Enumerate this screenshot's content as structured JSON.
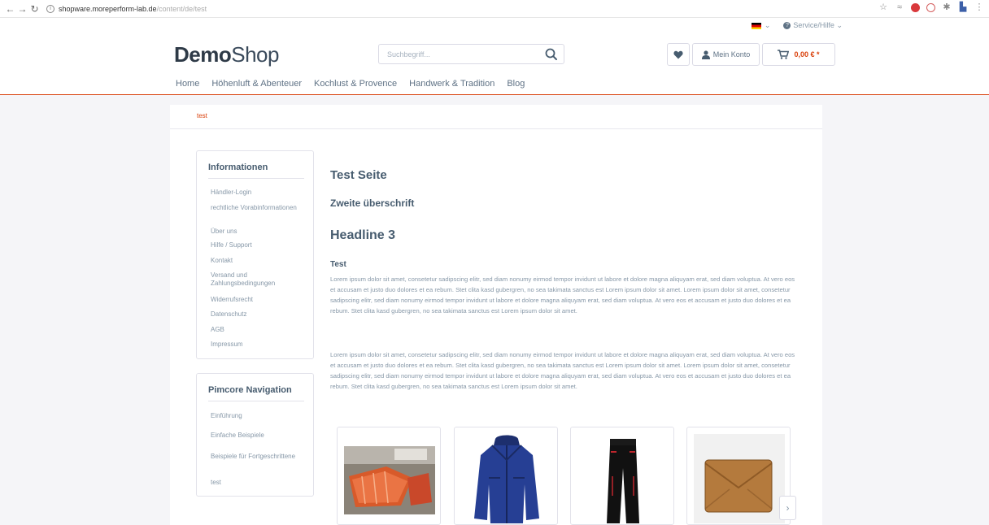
{
  "browser": {
    "back_icon": "back-arrow-icon",
    "forward_icon": "forward-arrow-icon",
    "reload_icon": "reload-icon",
    "url_host": "shopware.moreperform-lab.de",
    "url_path": "/content/de/test"
  },
  "topbar": {
    "language_icon": "german-flag-icon",
    "service_label": "Service/Hilfe"
  },
  "header": {
    "logo_bold": "Demo",
    "logo_light": "Shop",
    "search_placeholder": "Suchbegriff...",
    "account_label": "Mein Konto",
    "cart_amount": "0,00 € *"
  },
  "mainnav": [
    "Home",
    "Höhenluft & Abenteuer",
    "Kochlust & Provence",
    "Handwerk & Tradition",
    "Blog"
  ],
  "breadcrumb": "test",
  "sidebar": {
    "info_title": "Informationen",
    "info_links": [
      "Händler-Login",
      "rechtliche Vorabinformationen",
      "Über uns",
      "Hilfe / Support",
      "Kontakt",
      "Versand und Zahlungsbedingungen",
      "Widerrufsrecht",
      "Datenschutz",
      "AGB",
      "Impressum"
    ],
    "pimcore_title": "Pimcore Navigation",
    "pimcore_links": [
      "Einführung",
      "Einfache Beispiele",
      "Beispiele für Fortgeschrittene",
      "test"
    ]
  },
  "article": {
    "h1": "Test Seite",
    "h2": "Zweite überschrift",
    "h3": "Headline 3",
    "h4": "Test",
    "paragraph1": "Lorem ipsum dolor sit amet, consetetur sadipscing elitr, sed diam nonumy eirmod tempor invidunt ut labore et dolore magna aliquyam erat, sed diam voluptua. At vero eos et accusam et justo duo dolores et ea rebum. Stet clita kasd gubergren, no sea takimata sanctus est Lorem ipsum dolor sit amet. Lorem ipsum dolor sit amet, consetetur sadipscing elitr, sed diam nonumy eirmod tempor invidunt ut labore et dolore magna aliquyam erat, sed diam voluptua. At vero eos et accusam et justo duo dolores et ea rebum. Stet clita kasd gubergren, no sea takimata sanctus est Lorem ipsum dolor sit amet.",
    "paragraph2": "Lorem ipsum dolor sit amet, consetetur sadipscing elitr, sed diam nonumy eirmod tempor invidunt ut labore et dolore magna aliquyam erat, sed diam voluptua. At vero eos et accusam et justo duo dolores et ea rebum. Stet clita kasd gubergren, no sea takimata sanctus est Lorem ipsum dolor sit amet. Lorem ipsum dolor sit amet, consetetur sadipscing elitr, sed diam nonumy eirmod tempor invidunt ut labore et dolore magna aliquyam erat, sed diam voluptua. At vero eos et accusam et justo duo dolores et ea rebum. Stet clita kasd gubergren, no sea takimata sanctus est Lorem ipsum dolor sit amet."
  },
  "products": [
    {
      "icon": "salmon-fillet-image"
    },
    {
      "icon": "blue-jacket-image"
    },
    {
      "icon": "black-ski-pants-image"
    },
    {
      "icon": "brown-leather-bag-image"
    }
  ],
  "colors": {
    "accent": "#d9400b",
    "text": "#5f7285",
    "heading": "#475c6f",
    "page_bg": "#f5f5f8"
  }
}
